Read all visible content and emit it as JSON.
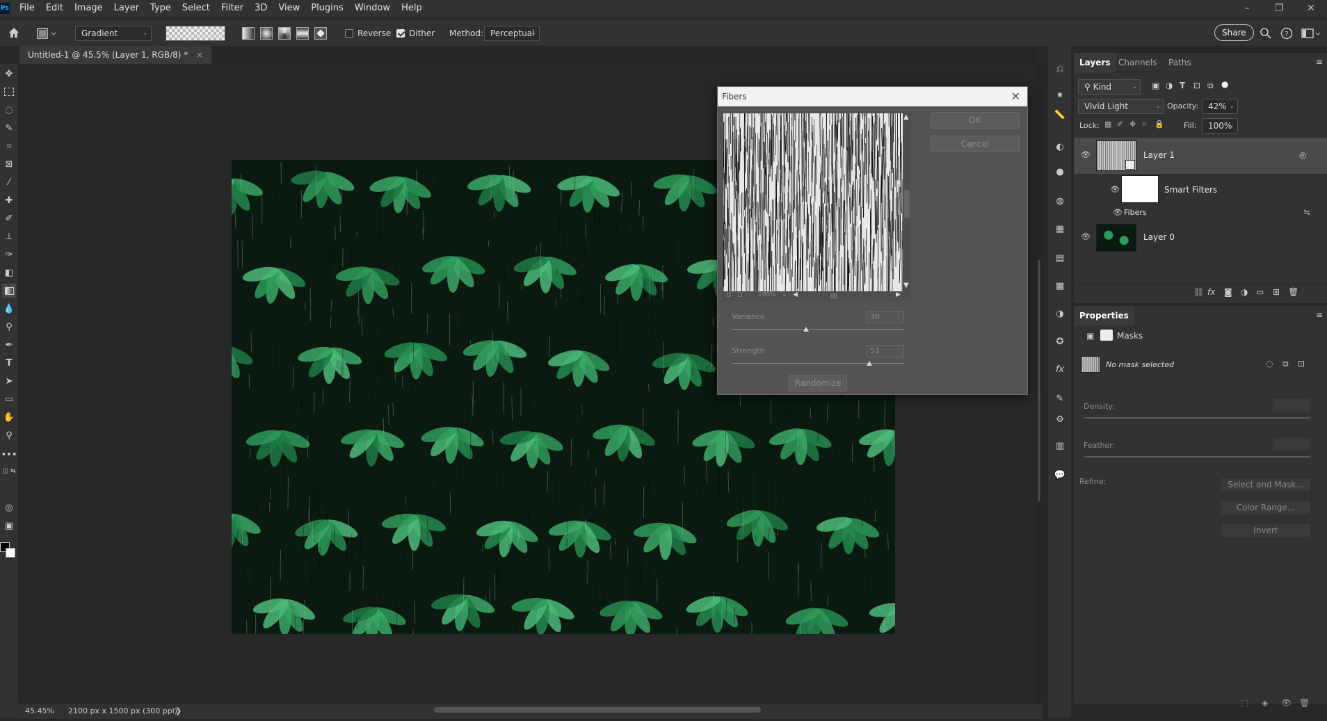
{
  "menubar": {
    "logo": "Ps",
    "items": [
      "File",
      "Edit",
      "Image",
      "Layer",
      "Type",
      "Select",
      "Filter",
      "3D",
      "View",
      "Plugins",
      "Window",
      "Help"
    ]
  },
  "window_controls": {
    "minimize": "–",
    "restore": "❐",
    "close": "✕"
  },
  "options": {
    "tool_preset": "Gradient",
    "reverse_label": "Reverse",
    "reverse_checked": false,
    "dither_label": "Dither",
    "dither_checked": true,
    "method_label": "Method:",
    "method_value": "Perceptual",
    "share_label": "Share"
  },
  "document": {
    "tab_title": "Untitled-1 @ 45.5% (Layer 1, RGB/8) *",
    "tab_close": "×"
  },
  "status": {
    "zoom": "45.45%",
    "doc_info": "2100 px x 1500 px (300 ppi)",
    "arrow": "❯"
  },
  "layers_panel": {
    "tabs": [
      "Layers",
      "Channels",
      "Paths"
    ],
    "filter_kind": "Kind",
    "blend_mode": "Vivid Light",
    "opacity_label": "Opacity:",
    "opacity_value": "42%",
    "lock_label": "Lock:",
    "fill_label": "Fill:",
    "fill_value": "100%",
    "layers": [
      {
        "name": "Layer 1"
      },
      {
        "name": "Smart Filters"
      },
      {
        "name": "Fibers"
      },
      {
        "name": "Layer 0"
      }
    ]
  },
  "properties_panel": {
    "title": "Properties",
    "section": "Masks",
    "mask_status": "No mask selected",
    "density_label": "Density:",
    "feather_label": "Feather:",
    "refine_label": "Refine:",
    "select_and_mask": "Select and Mask...",
    "color_range": "Color Range...",
    "invert": "Invert"
  },
  "fibers_dialog": {
    "title": "Fibers",
    "ok_label": "OK",
    "cancel_label": "Cancel",
    "zoom": "100%",
    "variance_label": "Variance",
    "variance_value": "30",
    "variance_fraction": 0.43,
    "strength_label": "Strength",
    "strength_value": "51",
    "strength_fraction": 0.8,
    "randomize_label": "Randomize"
  },
  "colors": {
    "app_bg": "#282828",
    "panel_bg": "#323232",
    "dialog_bg": "#535353",
    "leaf_green": "#2f9a5a"
  }
}
